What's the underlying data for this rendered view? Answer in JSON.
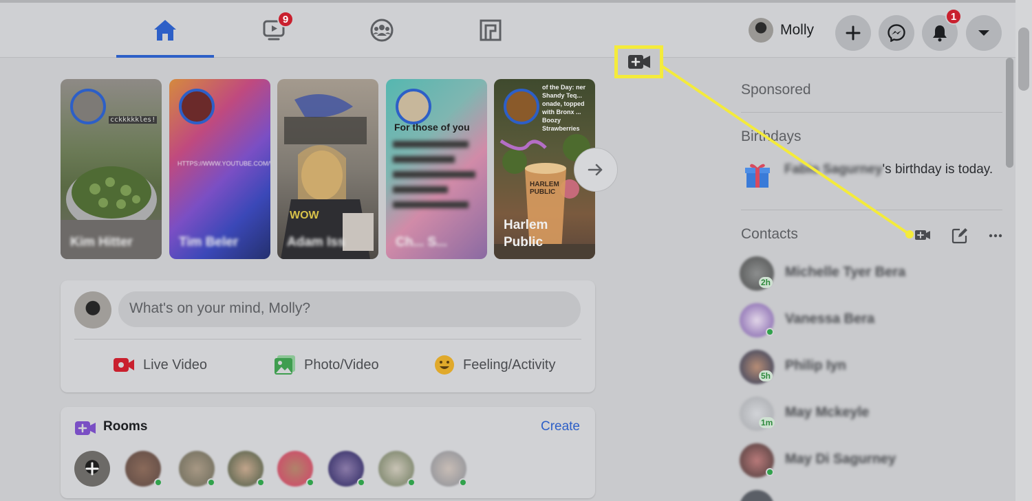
{
  "nav": {
    "tabs": [
      {
        "name": "home",
        "icon": "home-icon",
        "active": true
      },
      {
        "name": "watch",
        "icon": "watch-icon",
        "badge": "9"
      },
      {
        "name": "groups",
        "icon": "groups-icon"
      },
      {
        "name": "gaming",
        "icon": "gaming-icon"
      }
    ],
    "profile_name": "Molly",
    "notification_badge": "1",
    "accent": "#2d5fc7",
    "badge_color": "#c9202e"
  },
  "stories": [
    {
      "name": "Kim Hitter",
      "blurred": true,
      "overlay_text": "cckkkkkles!"
    },
    {
      "name": "Tim Beler",
      "blurred": true,
      "overlay_text": "HTTPS://WWW.YOUTUBE.COM/W"
    },
    {
      "name": "Adam Iss",
      "blurred": true,
      "overlay_text": "WOW"
    },
    {
      "name": "Ch... S...",
      "blurred": true,
      "overlay_text": "For those of you"
    },
    {
      "name": "Harlem Public",
      "blurred": false,
      "overlay_text": "of the Day: ner Shandy Teq... onade, topped with Bronx ... Boozy Strawberries"
    }
  ],
  "composer": {
    "placeholder": "What's on your mind, Molly?",
    "actions": [
      {
        "label": "Live Video",
        "icon": "live-video-icon",
        "color": "#c9202e"
      },
      {
        "label": "Photo/Video",
        "icon": "photo-icon",
        "color": "#3f9d4f"
      },
      {
        "label": "Feeling/Activity",
        "icon": "feeling-icon",
        "color": "#e0a92b"
      }
    ]
  },
  "rooms": {
    "title": "Rooms",
    "create_label": "Create"
  },
  "sidebar": {
    "sponsored_title": "Sponsored",
    "birthdays_title": "Birthdays",
    "birthday_name": "Fabio Sagurney",
    "birthday_suffix": "'s birthday is today.",
    "contacts_title": "Contacts",
    "contacts": [
      {
        "name": "Michelle Tyer Bera",
        "status": "2h"
      },
      {
        "name": "Vanessa Bera",
        "status": "online"
      },
      {
        "name": "Philip Iyn",
        "status": "5h"
      },
      {
        "name": "May Mckeyle",
        "status": "1m"
      },
      {
        "name": "May Di Sagurney",
        "status": "online"
      }
    ]
  },
  "callout": {
    "icon": "new-room-video-icon",
    "color": "#f4eb3b"
  }
}
